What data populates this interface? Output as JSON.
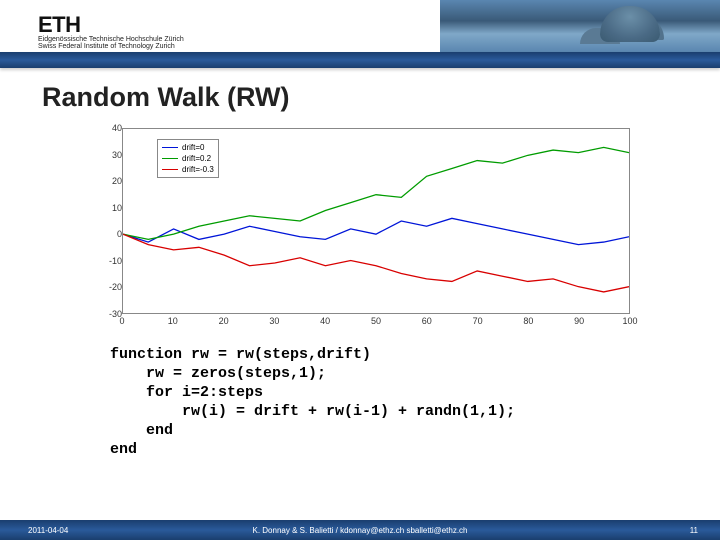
{
  "header": {
    "logo": "ETH",
    "subtitle": "Eidgenössische Technische Hochschule Zürich\nSwiss Federal Institute of Technology Zurich"
  },
  "title": "Random Walk (RW)",
  "chart_data": {
    "type": "line",
    "title": "",
    "xlabel": "",
    "ylabel": "",
    "xlim": [
      0,
      100
    ],
    "ylim": [
      -30,
      40
    ],
    "xticks": [
      0,
      10,
      20,
      30,
      40,
      50,
      60,
      70,
      80,
      90,
      100
    ],
    "yticks": [
      -30,
      -20,
      -10,
      0,
      10,
      20,
      30,
      40
    ],
    "legend_position": "upper-left",
    "series": [
      {
        "name": "drift=0",
        "color": "#0015d8",
        "x": [
          0,
          5,
          10,
          15,
          20,
          25,
          30,
          35,
          40,
          45,
          50,
          55,
          60,
          65,
          70,
          75,
          80,
          85,
          90,
          95,
          100
        ],
        "y": [
          0,
          -3,
          2,
          -2,
          0,
          3,
          1,
          -1,
          -2,
          2,
          0,
          5,
          3,
          6,
          4,
          2,
          0,
          -2,
          -4,
          -3,
          -1
        ]
      },
      {
        "name": "drift=0.2",
        "color": "#009c00",
        "x": [
          0,
          5,
          10,
          15,
          20,
          25,
          30,
          35,
          40,
          45,
          50,
          55,
          60,
          65,
          70,
          75,
          80,
          85,
          90,
          95,
          100
        ],
        "y": [
          0,
          -2,
          0,
          3,
          5,
          7,
          6,
          5,
          9,
          12,
          15,
          14,
          22,
          25,
          28,
          27,
          30,
          32,
          31,
          33,
          31
        ]
      },
      {
        "name": "drift=-0.3",
        "color": "#d80000",
        "x": [
          0,
          5,
          10,
          15,
          20,
          25,
          30,
          35,
          40,
          45,
          50,
          55,
          60,
          65,
          70,
          75,
          80,
          85,
          90,
          95,
          100
        ],
        "y": [
          0,
          -4,
          -6,
          -5,
          -8,
          -12,
          -11,
          -9,
          -12,
          -10,
          -12,
          -15,
          -17,
          -18,
          -14,
          -16,
          -18,
          -17,
          -20,
          -22,
          -20
        ]
      }
    ]
  },
  "legend": {
    "items": [
      {
        "label": "drift=0",
        "color": "#0015d8"
      },
      {
        "label": "drift=0.2",
        "color": "#009c00"
      },
      {
        "label": "drift=-0.3",
        "color": "#d80000"
      }
    ]
  },
  "code": "function rw = rw(steps,drift)\n    rw = zeros(steps,1);\n    for i=2:steps\n        rw(i) = drift + rw(i-1) + randn(1,1);\n    end\nend",
  "footer": {
    "date": "2011-04-04",
    "center": "K. Donnay & S. Balietti / kdonnay@ethz.ch   sballetti@ethz.ch",
    "page": "11"
  }
}
